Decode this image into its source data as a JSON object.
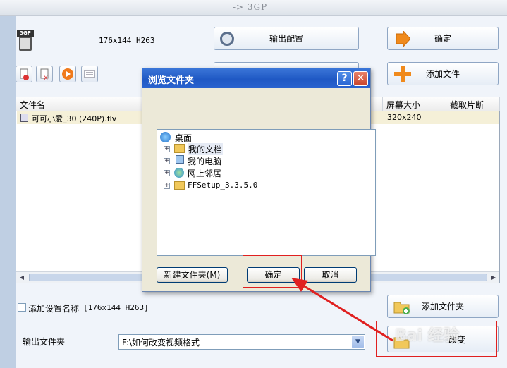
{
  "window": {
    "title": "-> 3GP"
  },
  "format": {
    "badge": "3GP",
    "info": "176x144 H263"
  },
  "buttons": {
    "output_config": "输出配置",
    "ok_main": "确定",
    "add_file": "添加文件",
    "add_folder": "添加文件夹",
    "change": "改变"
  },
  "toolbar": {
    "icons": [
      "remove-icon",
      "clear-icon",
      "play-icon",
      "info-icon"
    ]
  },
  "list": {
    "headers": [
      "文件名",
      "屏幕大小",
      "截取片断"
    ],
    "rows": [
      {
        "name": "可可小爱_30 (240P).flv",
        "size": "320x240"
      }
    ]
  },
  "settings": {
    "add_name_label": "添加设置名称",
    "add_name_value": "[176x144 H263]",
    "add_name_checked": false
  },
  "output": {
    "label": "输出文件夹",
    "path": "F:\\如何改变视频格式"
  },
  "dialog": {
    "title": "浏览文件夹",
    "tree": [
      {
        "label": "桌面",
        "icon": "desktop-icon"
      },
      {
        "label": "我的文档",
        "icon": "my-documents-icon"
      },
      {
        "label": "我的电脑",
        "icon": "my-computer-icon"
      },
      {
        "label": "网上邻居",
        "icon": "network-icon"
      },
      {
        "label": "FFSetup_3.3.5.0",
        "icon": "folder-icon"
      }
    ],
    "new_folder": "新建文件夹(M)",
    "ok": "确定",
    "cancel": "取消"
  },
  "watermark": "Bai 经验",
  "colors": {
    "dialog_title": "#2a63cf",
    "annotation": "#e02020"
  }
}
